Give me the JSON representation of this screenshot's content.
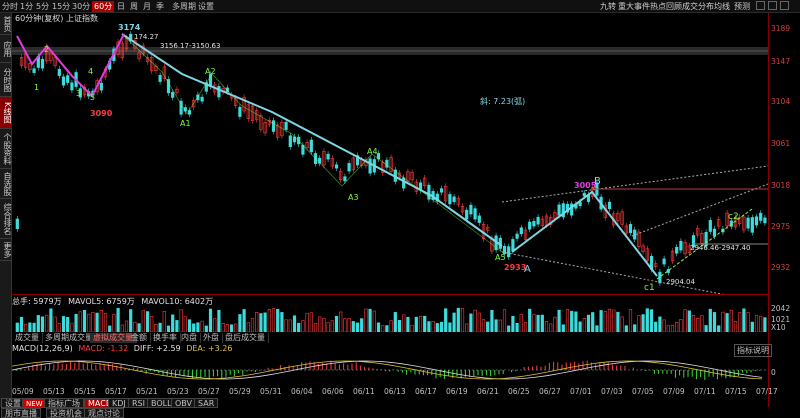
{
  "toolbar": {
    "left_items": [
      "分时",
      "1分",
      "5分",
      "15分",
      "30分",
      "60分",
      "日",
      "周",
      "月",
      "季",
      "多周期",
      "设置"
    ],
    "active_item": "60分",
    "right_items": [
      "九转",
      "重大事件",
      "热点回顾",
      "成交分布",
      "均线",
      "预测"
    ]
  },
  "leftnav": {
    "items": [
      "首页",
      "应用",
      "分时图",
      "K线图",
      "个股资料",
      "自选股",
      "综合排名",
      "更多"
    ],
    "active": "K线图"
  },
  "title": "60分钟(复权)  上证指数",
  "price_axis": [
    "3189",
    "3147",
    "3104",
    "3061",
    "3018",
    "2975",
    "2932"
  ],
  "volume_axis": [
    "2042",
    "1021",
    "X10"
  ],
  "annotations": {
    "peak": "3174",
    "peak_price": "174.27",
    "low1": "3090",
    "range_label": "3156.17-3150.63",
    "slope_text": "斜: 7.23(弧)",
    "low_a": "2933",
    "label_a": "A",
    "high_b": "3005",
    "label_b": "B",
    "c_range": "2946.46-2947.40",
    "c1_price": "2904.04",
    "label_c1": "c1",
    "label_c2": "c2",
    "wave_labels": [
      "1",
      "2",
      "3",
      "4",
      "5",
      "A1",
      "A2",
      "A3",
      "A4",
      "A5"
    ]
  },
  "volume_legend": {
    "total": "总手: 5979万",
    "ma5": "MAVOL5: 6759万",
    "ma10": "MAVOL10: 6402万"
  },
  "indicator_tabs": [
    "成交量",
    "多周期成交量",
    "虚拟成交量",
    "金额",
    "换手率",
    "内盘",
    "外盘",
    "盘后成交量"
  ],
  "active_indicator_tab": "虚拟成交量",
  "macd_legend": {
    "name": "MACD(12,26,9)",
    "macd": "MACD: -1.32",
    "diff": "DIFF: +2.59",
    "dea": "DEA: +3.26",
    "help": "指标说明",
    "zero": "0"
  },
  "dates": [
    "05/09",
    "05/13",
    "05/15",
    "05/17",
    "05/21",
    "05/23",
    "05/27",
    "05/29",
    "05/31",
    "06/04",
    "06/06",
    "06/11",
    "06/13",
    "06/17",
    "06/19",
    "06/21",
    "06/25",
    "06/27",
    "07/01",
    "07/03",
    "07/05",
    "07/09",
    "07/11",
    "07/15",
    "07/17"
  ],
  "bottom_tabs": [
    "设置",
    "NEW",
    "指标广场",
    "MACD",
    "KDJ",
    "RSI",
    "BOLL",
    "OBV",
    "SAR"
  ],
  "active_bottom_tab": "MACD",
  "footer_tabs": [
    "朋市直播",
    "投资机会",
    "观点讨论"
  ],
  "colors": {
    "up": "#ff3c3c",
    "down": "#3cdcdc",
    "trend": "#7fd7e6",
    "magenta": "#e23ce2",
    "wave_green": "#7dff3c",
    "accent_red": "#b00000"
  }
}
